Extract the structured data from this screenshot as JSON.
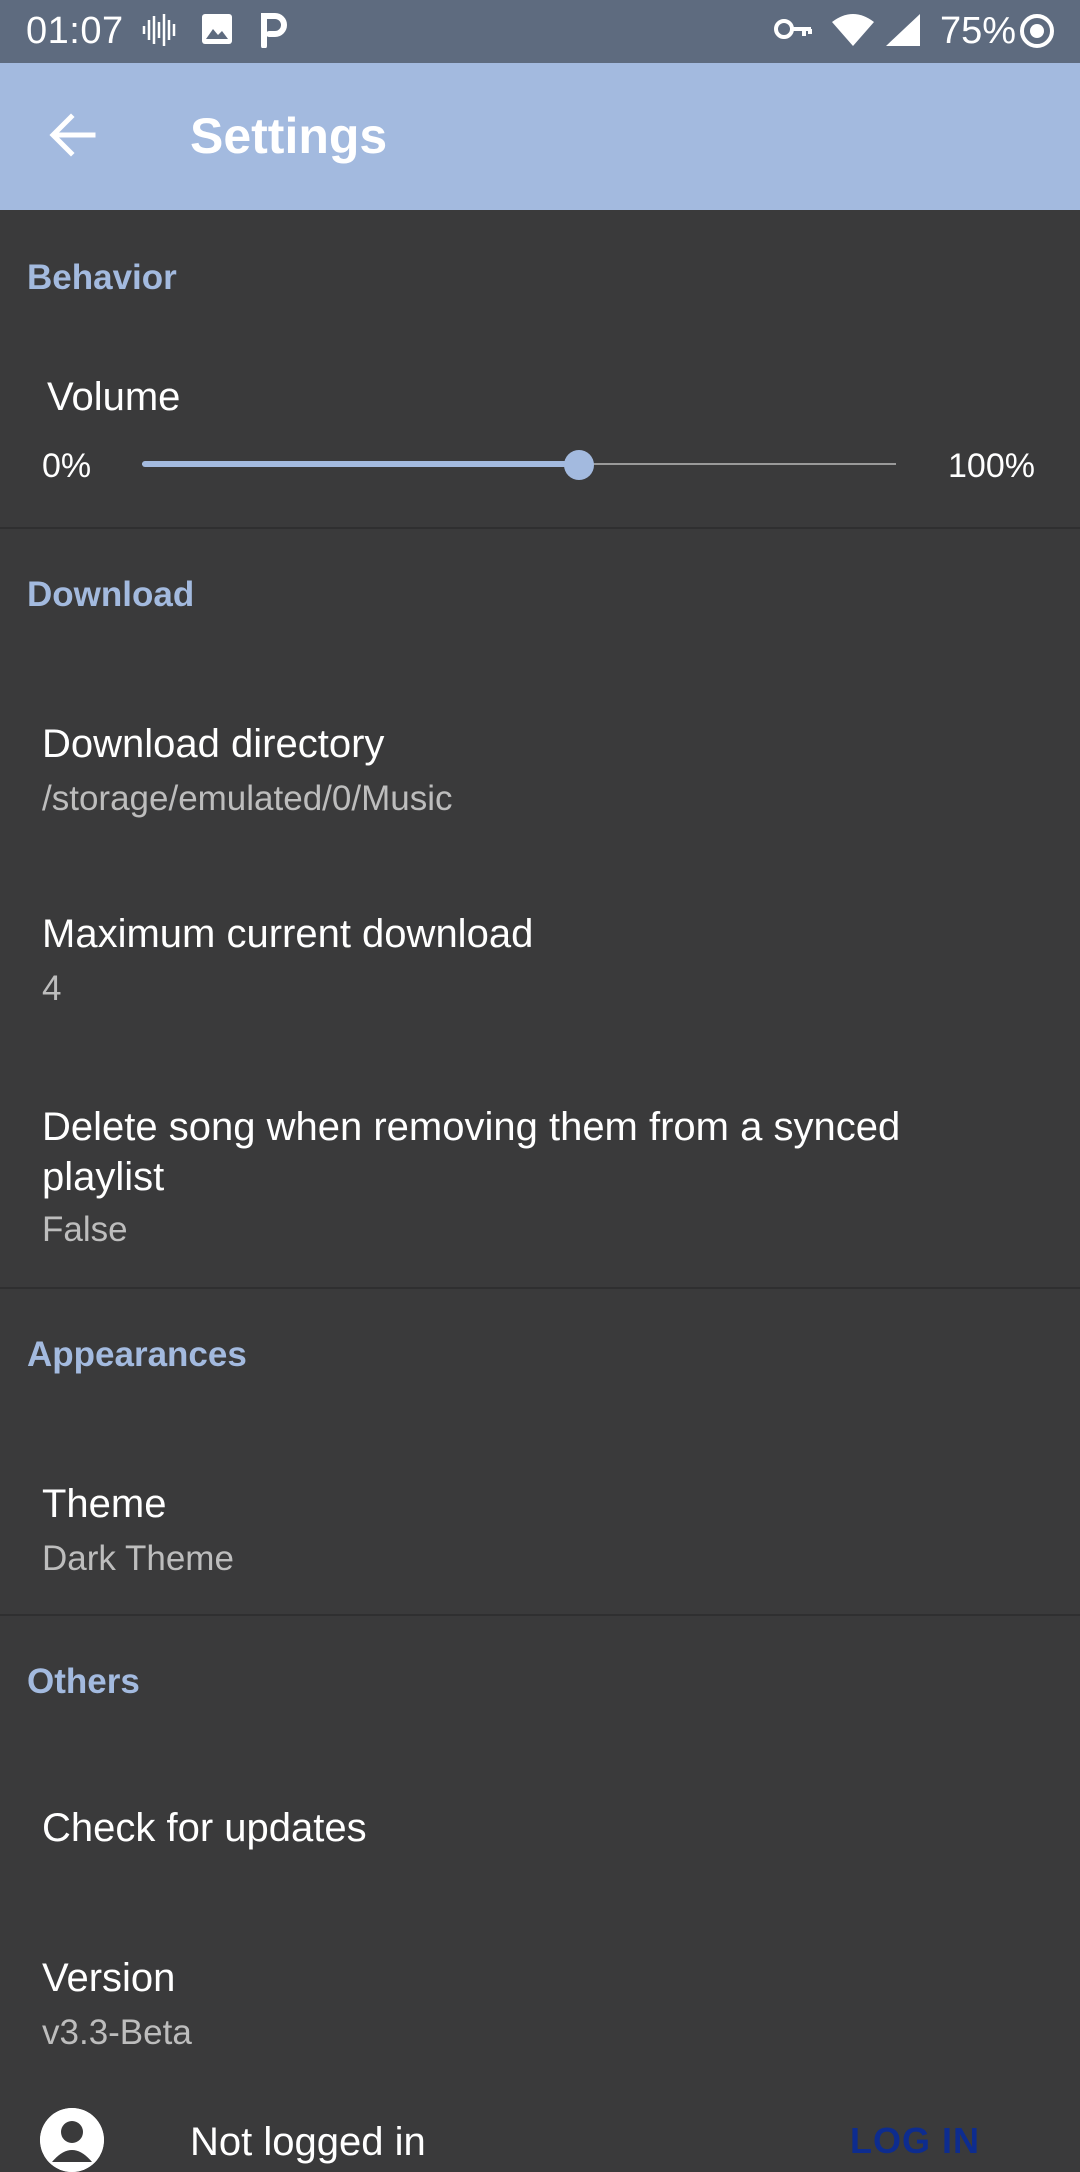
{
  "status_bar": {
    "time": "01:07",
    "battery": "75%",
    "icons": [
      "soundwave-icon",
      "image-icon",
      "parking-icon",
      "key-icon",
      "wifi-icon",
      "signal-icon",
      "sync-icon"
    ]
  },
  "app_bar": {
    "title": "Settings",
    "back_icon": "arrow-back-icon"
  },
  "sections": {
    "behavior": {
      "header": "Behavior",
      "volume": {
        "title": "Volume",
        "min_label": "0%",
        "max_label": "100%",
        "value_fraction": 0.58
      }
    },
    "download": {
      "header": "Download",
      "items": [
        {
          "title": "Download directory",
          "summary": "/storage/emulated/0/Music"
        },
        {
          "title": "Maximum current download",
          "summary": "4"
        },
        {
          "title": "Delete song when removing them from a synced playlist",
          "summary": "False"
        }
      ]
    },
    "appearances": {
      "header": "Appearances",
      "items": [
        {
          "title": "Theme",
          "summary": "Dark Theme"
        }
      ]
    },
    "others": {
      "header": "Others",
      "items": [
        {
          "title": "Check for updates"
        },
        {
          "title": "Version",
          "summary": "v3.3-Beta"
        }
      ],
      "account": {
        "status": "Not logged in",
        "login_label": "LOG IN"
      }
    }
  },
  "colors": {
    "status_bar": "#5e6b7f",
    "app_bar": "#a3badf",
    "background": "#3a3a3b",
    "accent": "#a3badf",
    "login_button": "#0d2c8f"
  }
}
